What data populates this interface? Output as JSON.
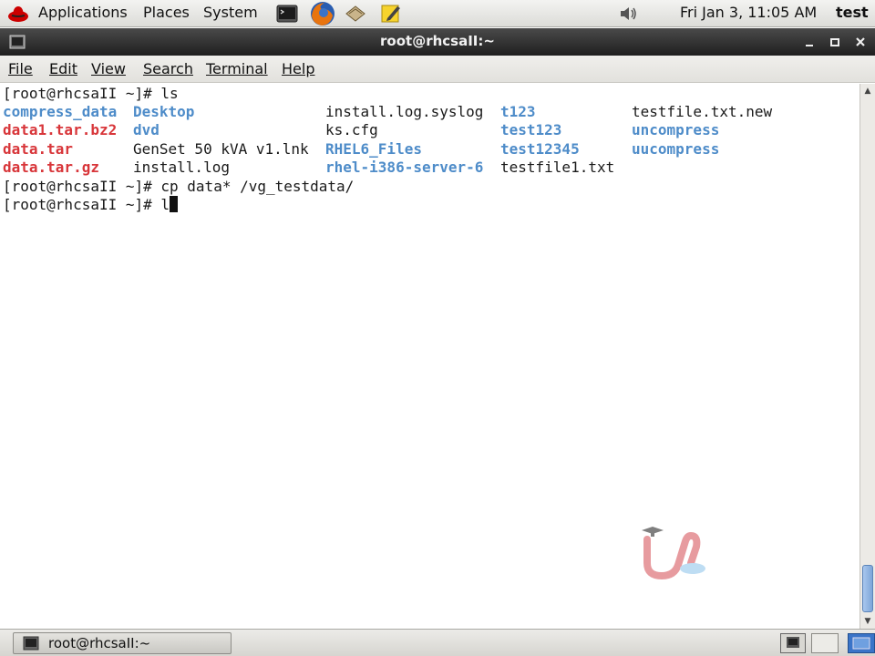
{
  "top_panel": {
    "menus": [
      "Applications",
      "Places",
      "System"
    ],
    "clock": "Fri Jan  3, 11:05 AM",
    "user": "test"
  },
  "window": {
    "title": "root@rhcsaII:~",
    "menubar": [
      "File",
      "Edit",
      "View",
      "Search",
      "Terminal",
      "Help"
    ]
  },
  "terminal": {
    "prompt1": "[root@rhcsaII ~]# ls",
    "ls_rows": [
      [
        {
          "text": "compress_data",
          "kind": "dir"
        },
        {
          "text": "Desktop",
          "kind": "dir"
        },
        {
          "text": "install.log.syslog",
          "kind": "file"
        },
        {
          "text": "t123",
          "kind": "dir"
        },
        {
          "text": "testfile.txt.new",
          "kind": "file"
        }
      ],
      [
        {
          "text": "data1.tar.bz2",
          "kind": "arc"
        },
        {
          "text": "dvd",
          "kind": "dir"
        },
        {
          "text": "ks.cfg",
          "kind": "file"
        },
        {
          "text": "test123",
          "kind": "dir"
        },
        {
          "text": "uncompress",
          "kind": "dir"
        }
      ],
      [
        {
          "text": "data.tar",
          "kind": "arc"
        },
        {
          "text": "GenSet 50 kVA v1.lnk",
          "kind": "file"
        },
        {
          "text": "RHEL6_Files",
          "kind": "dir"
        },
        {
          "text": "test12345",
          "kind": "dir"
        },
        {
          "text": "uucompress",
          "kind": "dir"
        }
      ],
      [
        {
          "text": "data.tar.gz",
          "kind": "arc"
        },
        {
          "text": "install.log",
          "kind": "file"
        },
        {
          "text": "rhel-i386-server-6",
          "kind": "dir"
        },
        {
          "text": "testfile1.txt",
          "kind": "file"
        },
        {
          "text": "",
          "kind": "file"
        }
      ]
    ],
    "prompt2": "[root@rhcsaII ~]# cp data* /vg_testdata/",
    "prompt3": "[root@rhcsaII ~]# l"
  },
  "taskbar": {
    "task_label": "root@rhcsaII:~"
  },
  "colors": {
    "dir": "#4e8cc9",
    "archive": "#d8363a",
    "text": "#1a1a1a"
  },
  "icons": [
    "redhat-logo-icon",
    "terminal-launcher-icon",
    "firefox-icon",
    "mail-icon",
    "notes-icon",
    "volume-icon",
    "show-desktop-icon",
    "workspace-switcher-icon"
  ]
}
